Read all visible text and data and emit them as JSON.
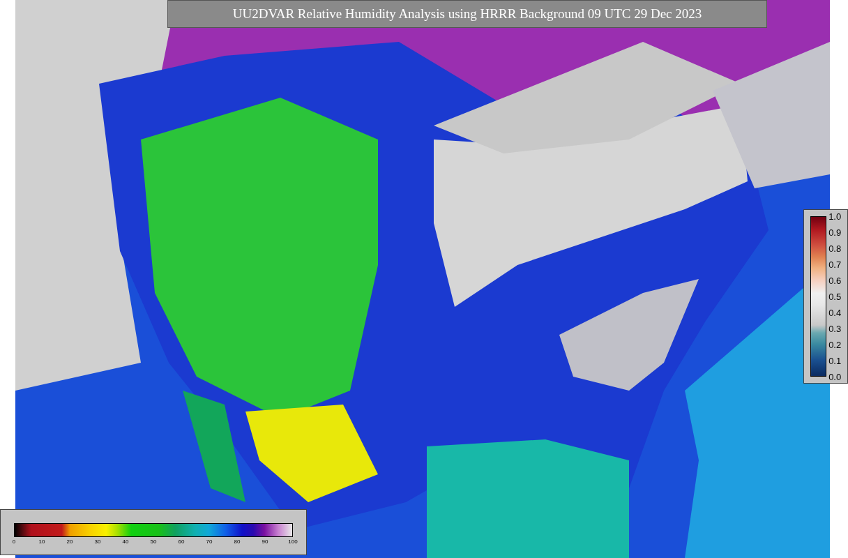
{
  "title": "UU2DVAR Relative Humidity Analysis using HRRR Background 09 UTC 29 Dec 2023",
  "scales": [
    {
      "kind": "horizontal",
      "ticks": [
        "0",
        "10",
        "20",
        "30",
        "40",
        "50",
        "60",
        "70",
        "80",
        "90",
        "100"
      ]
    },
    {
      "kind": "vertical",
      "ticks": [
        "1.0",
        "0.9",
        "0.8",
        "0.7",
        "0.6",
        "0.5",
        "0.4",
        "0.3",
        "0.2",
        "0.1",
        "0.0"
      ]
    }
  ]
}
